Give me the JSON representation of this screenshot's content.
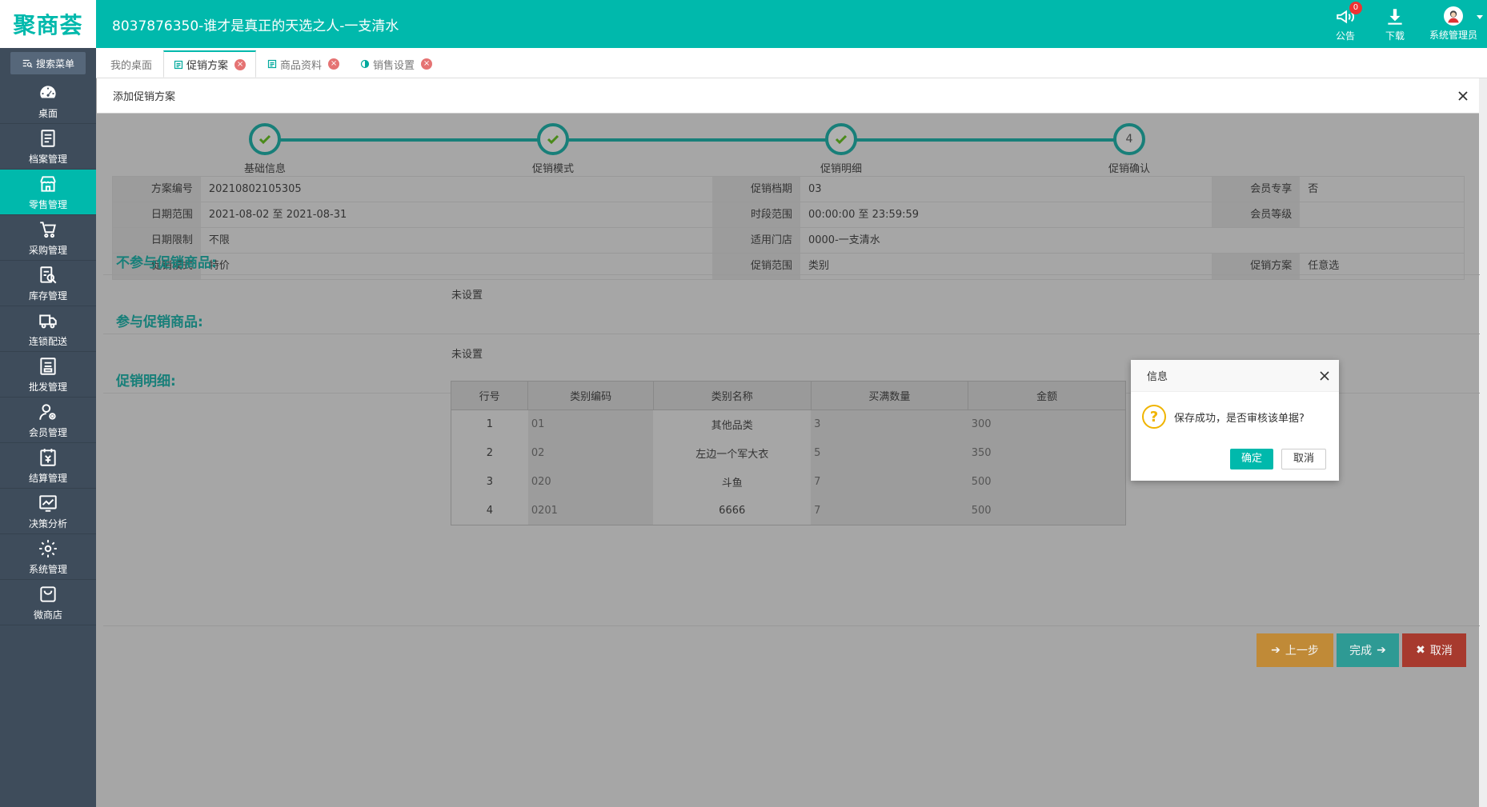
{
  "header": {
    "logo": "聚商荟",
    "title": "8037876350-谁才是真正的天选之人-一支清水",
    "notice_label": "公告",
    "notice_count": "0",
    "download_label": "下载",
    "user_label": "系统管理员"
  },
  "sidebar": {
    "search_label": "搜索菜单",
    "items": [
      {
        "label": "桌面",
        "icon": "dashboard-icon"
      },
      {
        "label": "档案管理",
        "icon": "archive-icon"
      },
      {
        "label": "零售管理",
        "icon": "store-icon",
        "active": true
      },
      {
        "label": "采购管理",
        "icon": "cart-icon"
      },
      {
        "label": "库存管理",
        "icon": "inventory-icon"
      },
      {
        "label": "连锁配送",
        "icon": "truck-icon"
      },
      {
        "label": "批发管理",
        "icon": "wholesale-icon"
      },
      {
        "label": "会员管理",
        "icon": "member-icon"
      },
      {
        "label": "结算管理",
        "icon": "settlement-icon"
      },
      {
        "label": "决策分析",
        "icon": "chart-icon"
      },
      {
        "label": "系统管理",
        "icon": "gear-icon"
      },
      {
        "label": "微商店",
        "icon": "bag-icon"
      }
    ]
  },
  "tabs": [
    {
      "label": "我的桌面"
    },
    {
      "label": "促销方案",
      "active": true
    },
    {
      "label": "商品资料"
    },
    {
      "label": "销售设置"
    }
  ],
  "panel": {
    "title": "添加促销方案"
  },
  "steps": [
    {
      "label": "基础信息",
      "done": true
    },
    {
      "label": "促销模式",
      "done": true
    },
    {
      "label": "促销明细",
      "done": true
    },
    {
      "label": "促销确认",
      "num": "4"
    }
  ],
  "info": {
    "row1": {
      "l1": "方案编号",
      "v1": "20210802105305",
      "l2": "促销档期",
      "v2": "03",
      "l3": "会员专享",
      "v3": "否"
    },
    "row2": {
      "l1": "日期范围",
      "v1": "2021-08-02 至 2021-08-31",
      "l2": "时段范围",
      "v2": "00:00:00 至 23:59:59",
      "l3": "会员等级",
      "v3": ""
    },
    "row3": {
      "l1": "日期限制",
      "v1": "不限",
      "l2": "适用门店",
      "v2": "0000-一支清水",
      "l3": "",
      "v3": ""
    },
    "row4": {
      "l1": "促销模式",
      "v1": "特价",
      "l2": "促销范围",
      "v2": "类别",
      "l3": "促销方案",
      "v3": "任意选"
    }
  },
  "sections": {
    "excluded_title": "不参与促销商品:",
    "excluded_value": "未设置",
    "included_title": "参与促销商品:",
    "included_value": "未设置",
    "detail_title": "促销明细:"
  },
  "table": {
    "headers": [
      "行号",
      "类别编码",
      "类别名称",
      "买满数量",
      "金额"
    ],
    "rows": [
      [
        "1",
        "01",
        "其他品类",
        "3",
        "300"
      ],
      [
        "2",
        "02",
        "左边一个军大衣",
        "5",
        "350"
      ],
      [
        "3",
        "020",
        "斗鱼",
        "7",
        "500"
      ],
      [
        "4",
        "0201",
        "6666",
        "7",
        "500"
      ]
    ]
  },
  "buttons": {
    "prev": "上一步",
    "finish": "完成",
    "cancel": "取消"
  },
  "dialog": {
    "title": "信息",
    "message": "保存成功，是否审核该单据?",
    "ok": "确定",
    "cancel": "取消"
  }
}
